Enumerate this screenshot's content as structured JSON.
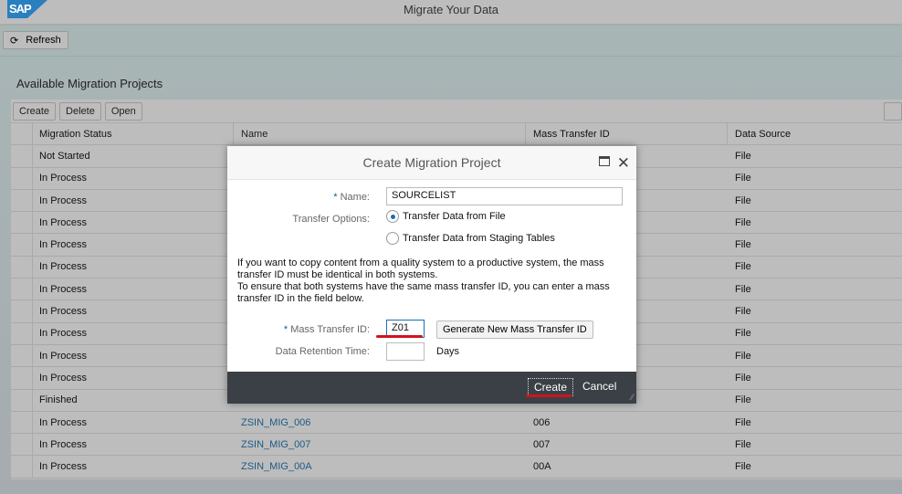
{
  "shell": {
    "logo": "SAP",
    "title": "Migrate Your Data"
  },
  "toolbar": {
    "refresh": "Refresh"
  },
  "page": {
    "title": "Available Migration Projects"
  },
  "table": {
    "actions": [
      "Create",
      "Delete",
      "Open"
    ],
    "columns": [
      "Migration Status",
      "Name",
      "Mass Transfer ID",
      "Data Source"
    ],
    "rows": [
      {
        "status": "Not Started",
        "name": "",
        "id": "",
        "source": "File"
      },
      {
        "status": "In Process",
        "name": "",
        "id": "",
        "source": "File"
      },
      {
        "status": "In Process",
        "name": "",
        "id": "",
        "source": "File"
      },
      {
        "status": "In Process",
        "name": "",
        "id": "",
        "source": "File"
      },
      {
        "status": "In Process",
        "name": "",
        "id": "",
        "source": "File"
      },
      {
        "status": "In Process",
        "name": "",
        "id": "",
        "source": "File"
      },
      {
        "status": "In Process",
        "name": "",
        "id": "",
        "source": "File"
      },
      {
        "status": "In Process",
        "name": "",
        "id": "",
        "source": "File"
      },
      {
        "status": "In Process",
        "name": "",
        "id": "",
        "source": "File"
      },
      {
        "status": "In Process",
        "name": "",
        "id": "",
        "source": "File"
      },
      {
        "status": "In Process",
        "name": "",
        "id": "",
        "source": "File"
      },
      {
        "status": "Finished",
        "name": "",
        "id": "",
        "source": "File"
      },
      {
        "status": "In Process",
        "name": "ZSIN_MIG_006",
        "id": "006",
        "source": "File"
      },
      {
        "status": "In Process",
        "name": "ZSIN_MIG_007",
        "id": "007",
        "source": "File"
      },
      {
        "status": "In Process",
        "name": "ZSIN_MIG_00A",
        "id": "00A",
        "source": "File"
      }
    ]
  },
  "dialog": {
    "title": "Create Migration Project",
    "name_label": "Name:",
    "name_value": "SOURCELIST",
    "transfer_label": "Transfer Options:",
    "options": [
      {
        "label": "Transfer Data from File",
        "selected": true
      },
      {
        "label": "Transfer Data from Staging Tables",
        "selected": false
      }
    ],
    "info": [
      "If you want to copy content from a quality system to a productive system, the mass transfer ID must be identical in both systems.",
      "To ensure that both systems have the same mass transfer ID, you can enter a mass transfer ID in the field below."
    ],
    "mtid_label": "Mass Transfer ID:",
    "mtid_value": "Z01",
    "generate": "Generate New Mass Transfer ID",
    "retention_label": "Data Retention Time:",
    "retention_value": "",
    "days": "Days",
    "create": "Create",
    "cancel": "Cancel"
  },
  "colors": {
    "accent": "#1a6fb3",
    "link": "#1b5a86",
    "footer": "#3a4045",
    "annotation": "#d0141b"
  }
}
